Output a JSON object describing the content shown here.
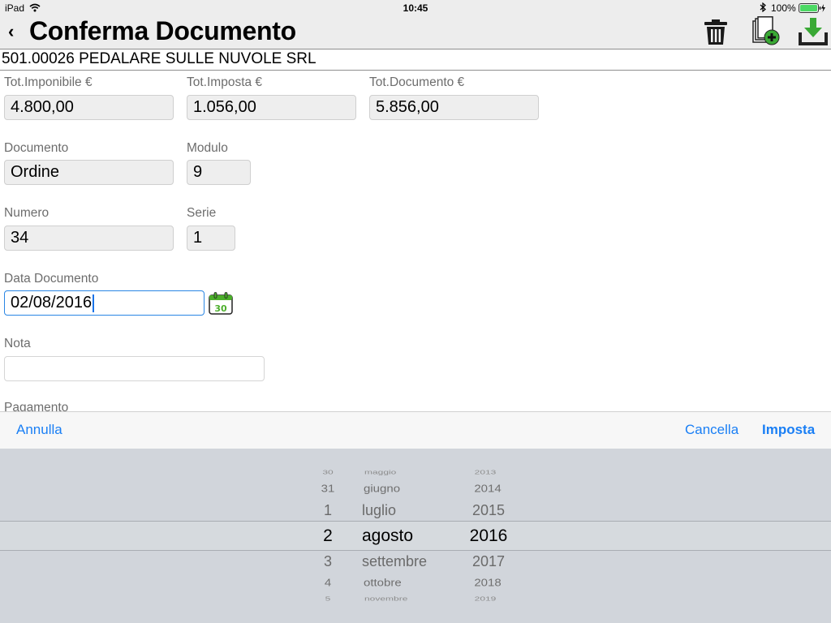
{
  "status_bar": {
    "device": "iPad",
    "time": "10:45",
    "battery_pct": "100%"
  },
  "nav": {
    "back_icon": "chevron-left-icon",
    "title": "Conferma Documento",
    "actions": [
      "trash-icon",
      "add-document-icon",
      "download-icon"
    ]
  },
  "customer": {
    "name": "501.00026 PEDALARE SULLE NUVOLE SRL"
  },
  "form": {
    "tot_imponibile": {
      "label": "Tot.Imponibile €",
      "value": "4.800,00"
    },
    "tot_imposta": {
      "label": "Tot.Imposta €",
      "value": "1.056,00"
    },
    "tot_documento": {
      "label": "Tot.Documento €",
      "value": "5.856,00"
    },
    "documento": {
      "label": "Documento",
      "value": "Ordine"
    },
    "modulo": {
      "label": "Modulo",
      "value": "9"
    },
    "numero": {
      "label": "Numero",
      "value": "34"
    },
    "serie": {
      "label": "Serie",
      "value": "1"
    },
    "data_documento": {
      "label": "Data Documento",
      "value": "02/08/2016",
      "calendar_icon_text": "30"
    },
    "nota": {
      "label": "Nota",
      "value": ""
    },
    "pagamento": {
      "label": "Pagamento"
    }
  },
  "toolbar": {
    "annulla": "Annulla",
    "cancella": "Cancella",
    "imposta": "Imposta"
  },
  "picker": {
    "selected": {
      "day": "2",
      "month": "agosto",
      "year": "2016"
    },
    "days": [
      "30",
      "31",
      "1",
      "2",
      "3",
      "4",
      "5"
    ],
    "months": [
      "maggio",
      "giugno",
      "luglio",
      "agosto",
      "settembre",
      "ottobre",
      "novembre"
    ],
    "years": [
      "2013",
      "2014",
      "2015",
      "2016",
      "2017",
      "2018",
      "2019"
    ]
  },
  "colors": {
    "accent": "#1a7ff5",
    "header_bg": "#ededed",
    "picker_bg": "#d1d5db",
    "calendar_green": "#4caf2b"
  }
}
